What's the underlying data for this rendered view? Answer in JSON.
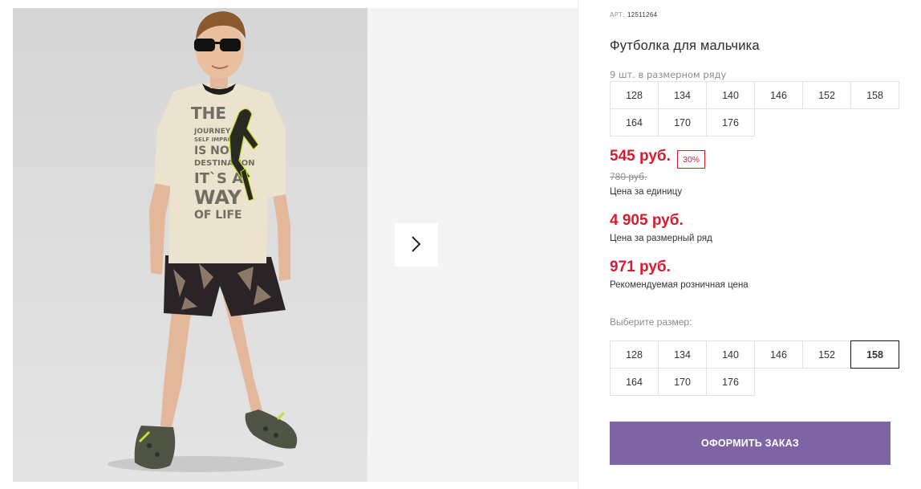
{
  "product": {
    "sku_label": "АРТ:",
    "sku_value": "12511264",
    "title": "Футболка для мальчика",
    "row_hint": "9 шт. в размерном ряду",
    "sizes_in_row": [
      "128",
      "134",
      "140",
      "146",
      "152",
      "158",
      "164",
      "170",
      "176"
    ]
  },
  "prices": {
    "current": "545 руб.",
    "discount": "30%",
    "old": "780 руб.",
    "unit_caption": "Цена за единицу",
    "row_total": "4 905 руб.",
    "row_caption": "Цена за размерный ряд",
    "rrp": "971 руб.",
    "rrp_caption": "Рекомендуемая розничная цена"
  },
  "size_selector": {
    "label": "Выберите размер:",
    "sizes": [
      "128",
      "134",
      "140",
      "146",
      "152",
      "158",
      "164",
      "170",
      "176"
    ],
    "selected": "158"
  },
  "order_button": {
    "label": "ОФОРМИТЬ ЗАКАЗ"
  },
  "gallery": {
    "next_icon": "chevron-right-icon",
    "shirt_print": [
      "THE",
      "JOURNEY",
      "SELF IMPROV",
      "IS NOT",
      "DESTINATION",
      "IT`S A",
      "WAY",
      "OF LIFE"
    ]
  },
  "colors": {
    "price_red": "#d81b2e",
    "button_purple": "#7d65a3",
    "photo_bg": "#dcdcdc",
    "next_area_bg": "#f4f4f4"
  }
}
